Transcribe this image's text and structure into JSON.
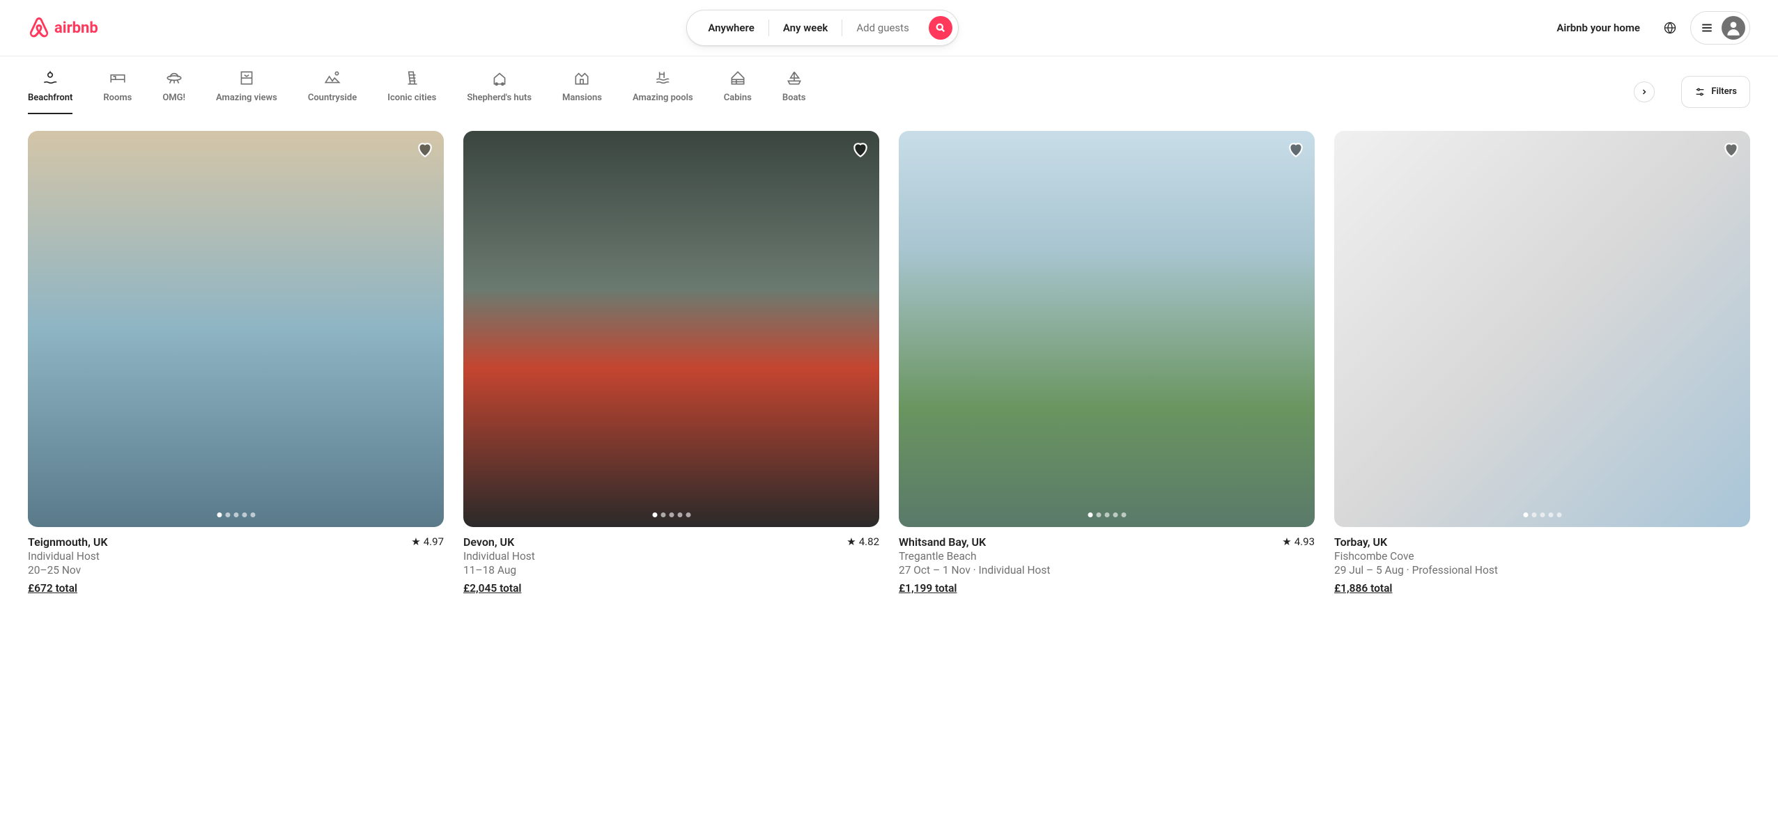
{
  "brand": "airbnb",
  "search": {
    "where": "Anywhere",
    "when": "Any week",
    "who_placeholder": "Add guests"
  },
  "nav": {
    "host": "Airbnb your home"
  },
  "categories": [
    {
      "label": "Beachfront",
      "icon": "beach",
      "active": true
    },
    {
      "label": "Rooms",
      "icon": "bed",
      "active": false
    },
    {
      "label": "OMG!",
      "icon": "ufo",
      "active": false
    },
    {
      "label": "Amazing views",
      "icon": "window",
      "active": false
    },
    {
      "label": "Countryside",
      "icon": "hills",
      "active": false
    },
    {
      "label": "Iconic cities",
      "icon": "tower",
      "active": false
    },
    {
      "label": "Shepherd's huts",
      "icon": "hut",
      "active": false
    },
    {
      "label": "Mansions",
      "icon": "mansion",
      "active": false
    },
    {
      "label": "Amazing pools",
      "icon": "pool",
      "active": false
    },
    {
      "label": "Cabins",
      "icon": "cabin",
      "active": false
    },
    {
      "label": "Boats",
      "icon": "boat",
      "active": false
    }
  ],
  "filters_label": "Filters",
  "listings": [
    {
      "title": "Teignmouth, UK",
      "rating": "4.97",
      "sub1": "Individual Host",
      "sub2": "20–25 Nov",
      "price": "£672 total"
    },
    {
      "title": "Devon, UK",
      "rating": "4.82",
      "sub1": "Individual Host",
      "sub2": "11–18 Aug",
      "price": "£2,045 total"
    },
    {
      "title": "Whitsand Bay, UK",
      "rating": "4.93",
      "sub1": "Tregantle Beach",
      "sub2": "27 Oct – 1 Nov · Individual Host",
      "price": "£1,199 total"
    },
    {
      "title": "Torbay, UK",
      "rating": "",
      "sub1": "Fishcombe Cove",
      "sub2": "29 Jul – 5 Aug · Professional Host",
      "price": "£1,886 total"
    }
  ]
}
